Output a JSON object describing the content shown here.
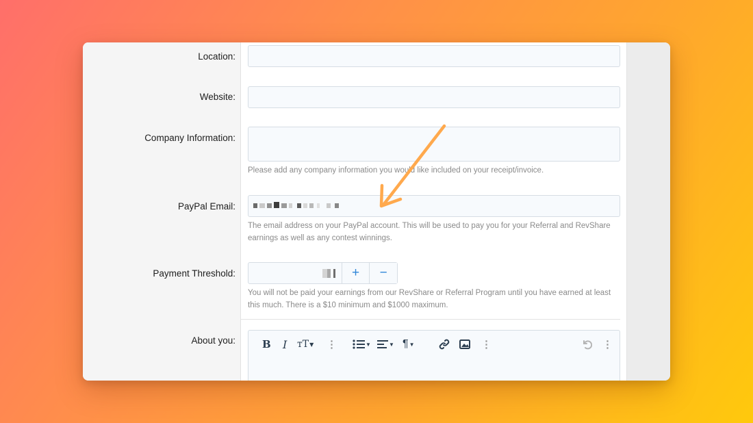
{
  "form": {
    "location": {
      "label": "Location:",
      "value": ""
    },
    "website": {
      "label": "Website:",
      "value": ""
    },
    "company": {
      "label": "Company Information:",
      "value": "",
      "hint": "Please add any company information you would like included on your receipt/invoice."
    },
    "paypal": {
      "label": "PayPal Email:",
      "hint": "The email address on your PayPal account. This will be used to pay you for your Referral and RevShare earnings as well as any contest winnings."
    },
    "threshold": {
      "label": "Payment Threshold:",
      "plus": "+",
      "minus": "−",
      "hint": "You will not be paid your earnings from our RevShare or Referral Program until you have earned at least this much. There is a $10 minimum and $1000 maximum."
    },
    "about": {
      "label": "About you:"
    }
  },
  "editor_toolbar": {
    "bold": "B",
    "italic": "I",
    "text_size": "тT",
    "paragraph": "¶",
    "icons": [
      "bold-icon",
      "italic-icon",
      "text-size-icon",
      "more-icon",
      "list-icon",
      "align-icon",
      "paragraph-icon",
      "link-icon",
      "image-icon",
      "more-icon",
      "undo-icon",
      "more-icon"
    ]
  },
  "colors": {
    "accent": "#2f86d8",
    "arrow": "#ffa94d",
    "background_start": "#ff6f6a",
    "background_end": "#ffc90c"
  }
}
